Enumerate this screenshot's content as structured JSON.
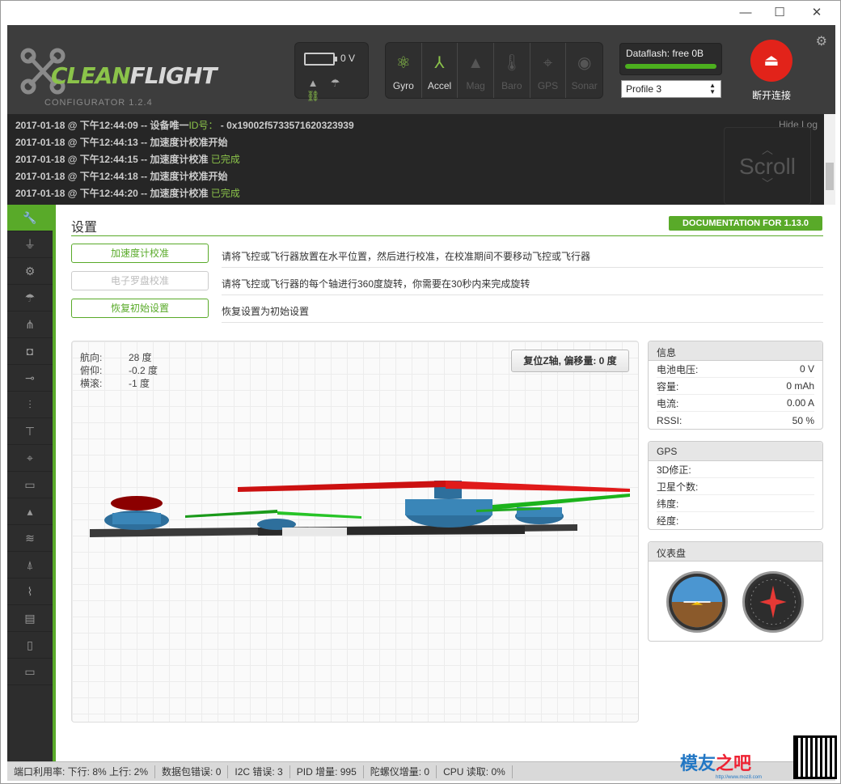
{
  "window": {
    "minimize": "—",
    "maximize": "☐",
    "close": "✕"
  },
  "header": {
    "logo_prefix": "CLEAN",
    "logo_suffix": "FLIGHT",
    "configurator": "CONFIGURATOR  1.2.4",
    "battery_voltage": "0 V",
    "sensors": [
      {
        "label": "Gyro",
        "icon": "gyro-icon",
        "glyph": "⚛",
        "active": true
      },
      {
        "label": "Accel",
        "icon": "accel-icon",
        "glyph": "⅄",
        "active": true
      },
      {
        "label": "Mag",
        "icon": "mag-icon",
        "glyph": "▲",
        "active": false
      },
      {
        "label": "Baro",
        "icon": "baro-icon",
        "glyph": "🌡",
        "active": false
      },
      {
        "label": "GPS",
        "icon": "gps-icon",
        "glyph": "⌖",
        "active": false
      },
      {
        "label": "Sonar",
        "icon": "sonar-icon",
        "glyph": "◉",
        "active": false
      }
    ],
    "dataflash": "Dataflash: free 0B",
    "profile": "Profile 3",
    "disconnect": "断开连接"
  },
  "log": {
    "hide_label": "Hide Log",
    "scroll_hint": "Scroll",
    "lines": [
      {
        "text": "2017-01-18 @ 下午12:44:09 -- 设备唯一",
        "label": "ID号：",
        "extra": " - 0x19002f5733571620323939",
        "green": ""
      },
      {
        "text": "2017-01-18 @ 下午12:44:13 -- 加速度计校准开始",
        "label": "",
        "extra": "",
        "green": ""
      },
      {
        "text": "2017-01-18 @ 下午12:44:15 -- 加速度计校准 ",
        "label": "",
        "extra": "",
        "green": "已完成"
      },
      {
        "text": "2017-01-18 @ 下午12:44:18 -- 加速度计校准开始",
        "label": "",
        "extra": "",
        "green": ""
      },
      {
        "text": "2017-01-18 @ 下午12:44:20 -- 加速度计校准 ",
        "label": "",
        "extra": "",
        "green": "已完成"
      }
    ]
  },
  "sidebar": {
    "items": [
      {
        "icon": "wrench-icon",
        "glyph": "🔧",
        "active": true
      },
      {
        "icon": "ports-icon",
        "glyph": "⏚",
        "active": false
      },
      {
        "icon": "gear-icon",
        "glyph": "⚙",
        "active": false
      },
      {
        "icon": "failsafe-icon",
        "glyph": "☂",
        "active": false
      },
      {
        "icon": "pid-icon",
        "glyph": "⋔",
        "active": false
      },
      {
        "icon": "receiver-icon",
        "glyph": "◘",
        "active": false
      },
      {
        "icon": "modes-icon",
        "glyph": "⊸",
        "active": false
      },
      {
        "icon": "adjustments-icon",
        "glyph": "⫶",
        "active": false
      },
      {
        "icon": "servos-icon",
        "glyph": "⊤",
        "active": false
      },
      {
        "icon": "gps-icon",
        "glyph": "⌖",
        "active": false
      },
      {
        "icon": "motors-icon",
        "glyph": "▭",
        "active": false
      },
      {
        "icon": "led-icon",
        "glyph": "▴",
        "active": false
      },
      {
        "icon": "sensors-icon",
        "glyph": "≋",
        "active": false
      },
      {
        "icon": "tethered-icon",
        "glyph": "⍋",
        "active": false
      },
      {
        "icon": "logging-icon",
        "glyph": "⌇",
        "active": false
      },
      {
        "icon": "dataflash-icon",
        "glyph": "▤",
        "active": false
      },
      {
        "icon": "cli-icon",
        "glyph": "▯",
        "active": false
      },
      {
        "icon": "terminal-icon",
        "glyph": "▭",
        "active": false
      }
    ]
  },
  "setup": {
    "title": "设置",
    "doc_button": "DOCUMENTATION FOR 1.13.0",
    "actions": [
      {
        "button": "加速度计校准",
        "desc": "请将飞控或飞行器放置在水平位置，然后进行校准，在校准期间不要移动飞控或飞行器",
        "disabled": false
      },
      {
        "button": "电子罗盘校准",
        "desc": "请将飞控或飞行器的每个轴进行360度旋转，你需要在30秒内来完成旋转",
        "disabled": true
      },
      {
        "button": "恢复初始设置",
        "desc": "恢复设置为初始设置",
        "disabled": false
      }
    ],
    "attitude": [
      {
        "k": "航向:",
        "v": "28 度"
      },
      {
        "k": "俯仰:",
        "v": "-0.2 度"
      },
      {
        "k": "横滚:",
        "v": "-1 度"
      }
    ],
    "reset_z": "复位Z轴, 偏移量: 0 度"
  },
  "info": {
    "title": "信息",
    "rows": [
      {
        "k": "电池电压:",
        "v": "0 V"
      },
      {
        "k": "容量:",
        "v": "0 mAh"
      },
      {
        "k": "电流:",
        "v": "0.00 A"
      },
      {
        "k": "RSSI:",
        "v": "50 %"
      }
    ]
  },
  "gps": {
    "title": "GPS",
    "rows": [
      {
        "k": "3D修正:",
        "v": ""
      },
      {
        "k": "卫星个数:",
        "v": ""
      },
      {
        "k": "纬度:",
        "v": ""
      },
      {
        "k": "经度:",
        "v": ""
      }
    ]
  },
  "instruments": {
    "title": "仪表盘"
  },
  "status": {
    "segments": [
      "端口利用率:  下行:  8% 上行:  2%",
      "数据包错误:  0",
      "I2C 错误:  3",
      "PID 增量:  995",
      "陀螺仪增量:  0",
      "CPU 读取:  0%"
    ]
  },
  "watermark": {
    "brand_a": "模友",
    "brand_b": "之吧",
    "url": "http://www.moz8.com"
  },
  "colors": {
    "accent": "#59aa29",
    "header_bg": "#3d3d3d",
    "disconnect": "#e2231a"
  }
}
